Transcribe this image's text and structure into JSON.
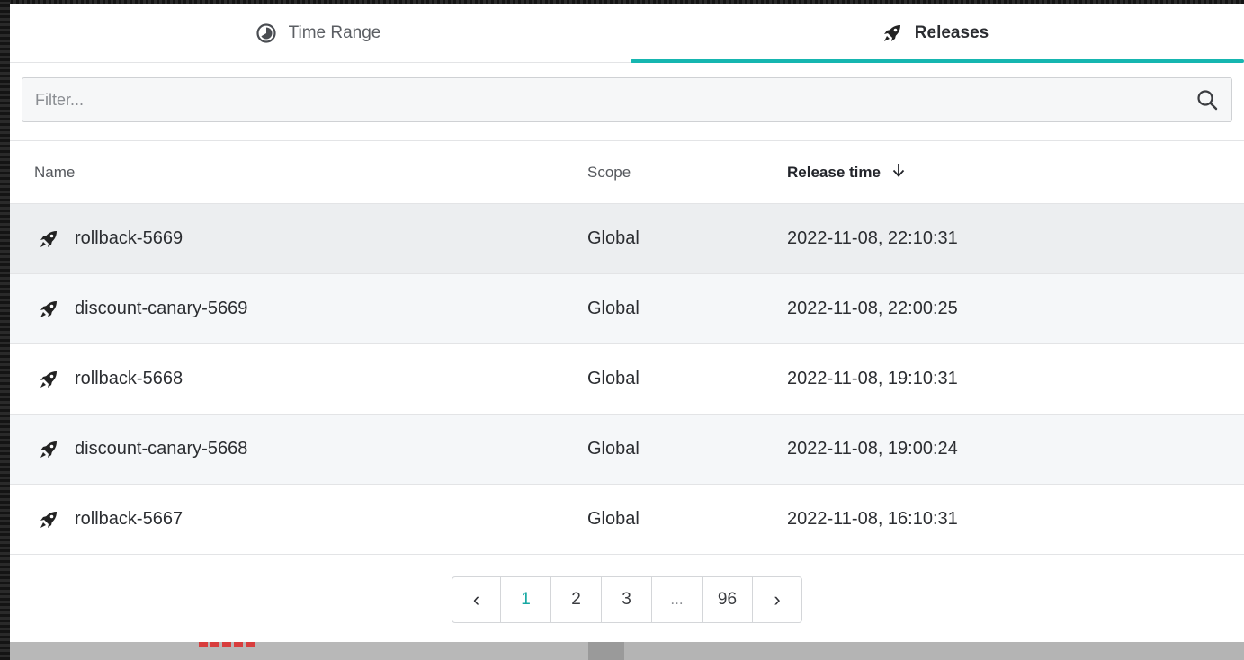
{
  "tabs": [
    {
      "label": "Time Range",
      "icon": "clock-half-icon",
      "active": false
    },
    {
      "label": "Releases",
      "icon": "rocket-icon",
      "active": true
    }
  ],
  "filter": {
    "placeholder": "Filter...",
    "value": ""
  },
  "table": {
    "headers": {
      "name": "Name",
      "scope": "Scope",
      "time": "Release time"
    },
    "sort": {
      "column": "time",
      "direction": "desc"
    },
    "rows": [
      {
        "name": "rollback-5669",
        "scope": "Global",
        "time": "2022-11-08, 22:10:31"
      },
      {
        "name": "discount-canary-5669",
        "scope": "Global",
        "time": "2022-11-08, 22:00:25"
      },
      {
        "name": "rollback-5668",
        "scope": "Global",
        "time": "2022-11-08, 19:10:31"
      },
      {
        "name": "discount-canary-5668",
        "scope": "Global",
        "time": "2022-11-08, 19:00:24"
      },
      {
        "name": "rollback-5667",
        "scope": "Global",
        "time": "2022-11-08, 16:10:31"
      }
    ]
  },
  "pagination": {
    "prev": "‹",
    "pages": [
      "1",
      "2",
      "3"
    ],
    "ellipsis": "...",
    "last": "96",
    "next": "›",
    "current": "1"
  },
  "colors": {
    "accent": "#16b6b0",
    "hover_row": "#eceef0",
    "alt_row": "#f5f7f9"
  }
}
